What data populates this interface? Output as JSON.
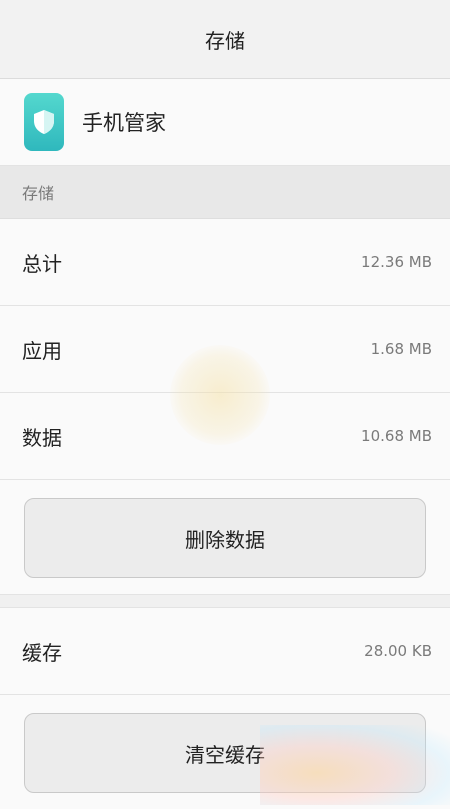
{
  "header": {
    "title": "存储"
  },
  "app": {
    "name": "手机管家",
    "icon": "shield-icon",
    "icon_color": "#3cc4c4"
  },
  "storage": {
    "section_label": "存储",
    "rows": [
      {
        "label": "总计",
        "value": "12.36 MB"
      },
      {
        "label": "应用",
        "value": "1.68 MB"
      },
      {
        "label": "数据",
        "value": "10.68 MB"
      }
    ],
    "delete_button": "删除数据"
  },
  "cache": {
    "label": "缓存",
    "value": "28.00 KB",
    "clear_button": "清空缓存"
  }
}
